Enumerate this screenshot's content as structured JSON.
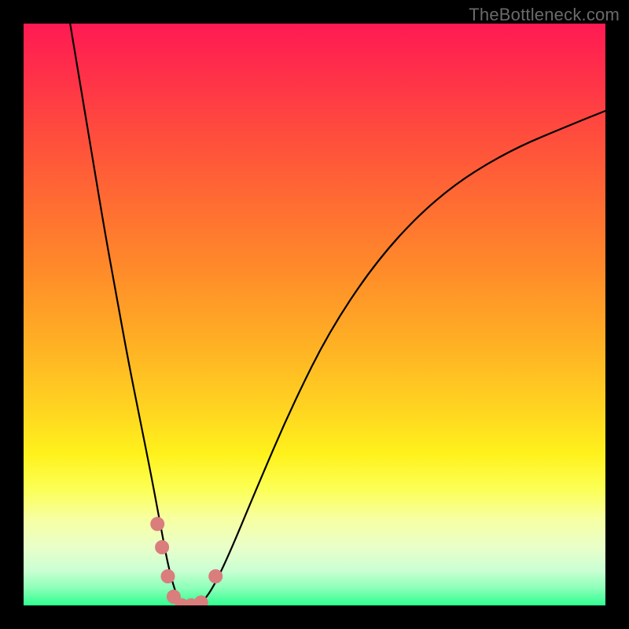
{
  "watermark": "TheBottleneck.com",
  "chart_data": {
    "type": "line",
    "title": "",
    "xlabel": "",
    "ylabel": "",
    "xlim": [
      0,
      100
    ],
    "ylim": [
      0,
      100
    ],
    "series": [
      {
        "name": "curve",
        "x": [
          8,
          10,
          12,
          14,
          16,
          18,
          20,
          22,
          23.5,
          25,
          26.5,
          28,
          30,
          32,
          35,
          40,
          46,
          53,
          62,
          72,
          83,
          95,
          100
        ],
        "values": [
          100,
          88,
          76,
          64,
          53,
          42,
          32,
          22,
          14,
          6,
          1,
          0,
          0,
          2,
          8,
          20,
          34,
          48,
          61,
          71,
          78,
          83,
          85
        ]
      }
    ],
    "markers": [
      {
        "x": 23.0,
        "y": 14.0
      },
      {
        "x": 23.8,
        "y": 10.0
      },
      {
        "x": 24.8,
        "y": 5.0
      },
      {
        "x": 25.8,
        "y": 1.5
      },
      {
        "x": 27.2,
        "y": 0.0
      },
      {
        "x": 28.8,
        "y": 0.0
      },
      {
        "x": 30.5,
        "y": 0.5
      },
      {
        "x": 33.0,
        "y": 5.0
      }
    ],
    "marker_color": "#d97d7d",
    "curve_color": "#000000",
    "gradient_stops": [
      {
        "pct": 0,
        "color": "#ff1a53"
      },
      {
        "pct": 8,
        "color": "#ff2e4a"
      },
      {
        "pct": 18,
        "color": "#ff4a3e"
      },
      {
        "pct": 30,
        "color": "#ff6a33"
      },
      {
        "pct": 42,
        "color": "#ff8a2a"
      },
      {
        "pct": 55,
        "color": "#ffb024"
      },
      {
        "pct": 66,
        "color": "#ffd321"
      },
      {
        "pct": 74,
        "color": "#fff21c"
      },
      {
        "pct": 80,
        "color": "#fcff55"
      },
      {
        "pct": 85,
        "color": "#f7ffa0"
      },
      {
        "pct": 90,
        "color": "#e9ffc9"
      },
      {
        "pct": 94,
        "color": "#caffd3"
      },
      {
        "pct": 97,
        "color": "#8dffb9"
      },
      {
        "pct": 100,
        "color": "#2fff90"
      }
    ]
  }
}
